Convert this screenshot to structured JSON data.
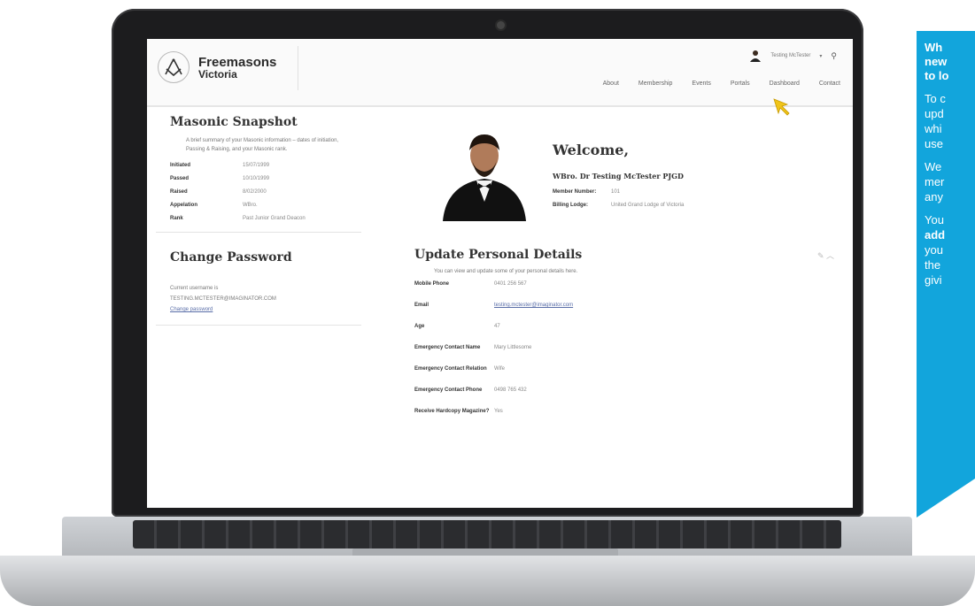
{
  "site": {
    "logo_line1": "Freemasons",
    "logo_line2": "Victoria",
    "user_name": "Testing McTester",
    "nav": [
      "About",
      "Membership",
      "Events",
      "Portals",
      "Dashboard",
      "Contact"
    ]
  },
  "snapshot": {
    "title": "Masonic Snapshot",
    "description": "A brief summary of your Masonic information – dates of initiation, Passing & Raising, and your Masonic rank.",
    "rows": [
      {
        "label": "Initiated",
        "value": "15/07/1999"
      },
      {
        "label": "Passed",
        "value": "10/10/1999"
      },
      {
        "label": "Raised",
        "value": "8/02/2000"
      },
      {
        "label": "Appelation",
        "value": "WBro."
      },
      {
        "label": "Rank",
        "value": "Past Junior Grand Deacon"
      }
    ]
  },
  "password": {
    "title": "Change Password",
    "username_label": "Current username is",
    "username_value": "TESTING.MCTESTER@IMAGINATOR.COM",
    "change_link": "Change password"
  },
  "welcome": {
    "heading": "Welcome,",
    "name": "WBro. Dr Testing McTester PJGD",
    "rows": [
      {
        "label": "Member Number:",
        "value": "101"
      },
      {
        "label": "Billing Lodge:",
        "value": "United Grand Lodge of Victoria"
      }
    ]
  },
  "update": {
    "title": "Update Personal Details",
    "description": "You can view and update some of your personal details here.",
    "rows": [
      {
        "label": "Mobile Phone",
        "value": "0401 256 567"
      },
      {
        "label": "Email",
        "value": "testing.mctester@imaginator.com"
      },
      {
        "label": "Age",
        "value": "47"
      },
      {
        "label": "Emergency Contact Name",
        "value": "Mary Littlesome"
      },
      {
        "label": "Emergency Contact Relation",
        "value": "Wife"
      },
      {
        "label": "Emergency Contact Phone",
        "value": "0498 765 432"
      },
      {
        "label": "Receive Hardcopy Magazine?",
        "value": "Yes"
      }
    ]
  },
  "promo": {
    "heading": "Wh\nnew\nto lo",
    "p1": "To c\nupd\nwhi\nuse",
    "p2": "We\nmer\nany",
    "p3a": "You",
    "p3b": "add",
    "p3c": "you\nthe\ngivi"
  },
  "colors": {
    "promo_bg": "#12a5dc",
    "link": "#5a6ea8",
    "cursor": "#f0c419"
  }
}
